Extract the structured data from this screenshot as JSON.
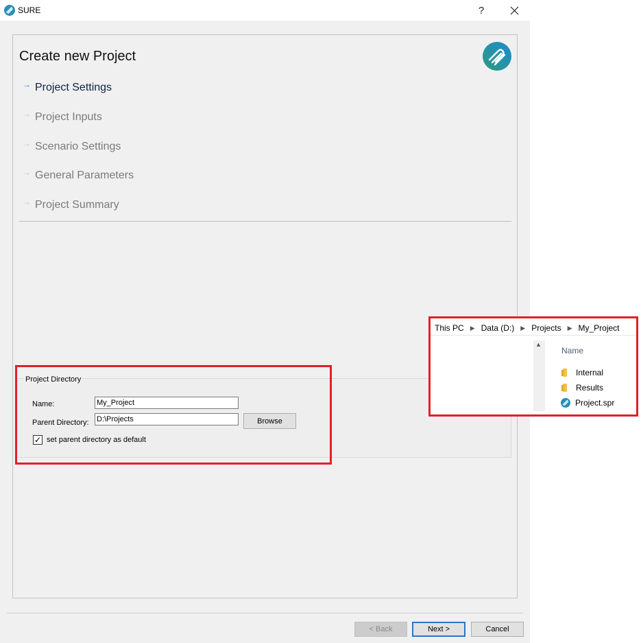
{
  "window": {
    "title": "SURE",
    "help_label": "?",
    "close_label": "✕"
  },
  "wizard": {
    "title": "Create new Project",
    "steps": [
      {
        "label": "Project Settings",
        "active": true
      },
      {
        "label": "Project Inputs",
        "active": false
      },
      {
        "label": "Scenario Settings",
        "active": false
      },
      {
        "label": "General Parameters",
        "active": false
      },
      {
        "label": "Project Summary",
        "active": false
      }
    ],
    "step_arrow": "→"
  },
  "project_directory": {
    "group_title": "Project Directory",
    "name_label": "Name:",
    "name_value": "My_Project",
    "parent_label": "Parent Directory:",
    "parent_value": "D:\\Projects",
    "browse_label": "Browse",
    "default_checked": true,
    "default_label": "set parent directory as default"
  },
  "footer": {
    "back_label": "< Back",
    "next_label": "Next >",
    "cancel_label": "Cancel"
  },
  "explorer": {
    "breadcrumb": [
      "This PC",
      "Data (D:)",
      "Projects",
      "My_Project"
    ],
    "column_header": "Name",
    "items": [
      {
        "name": "Internal",
        "icon": "folder-icon"
      },
      {
        "name": "Results",
        "icon": "folder-icon"
      },
      {
        "name": "Project.spr",
        "icon": "sure-file-icon"
      }
    ]
  },
  "colors": {
    "highlight": "#e0202a",
    "logo_teal": "#2e9a7e",
    "logo_blue": "#1f8ad0",
    "active_step": "#0c2340"
  }
}
